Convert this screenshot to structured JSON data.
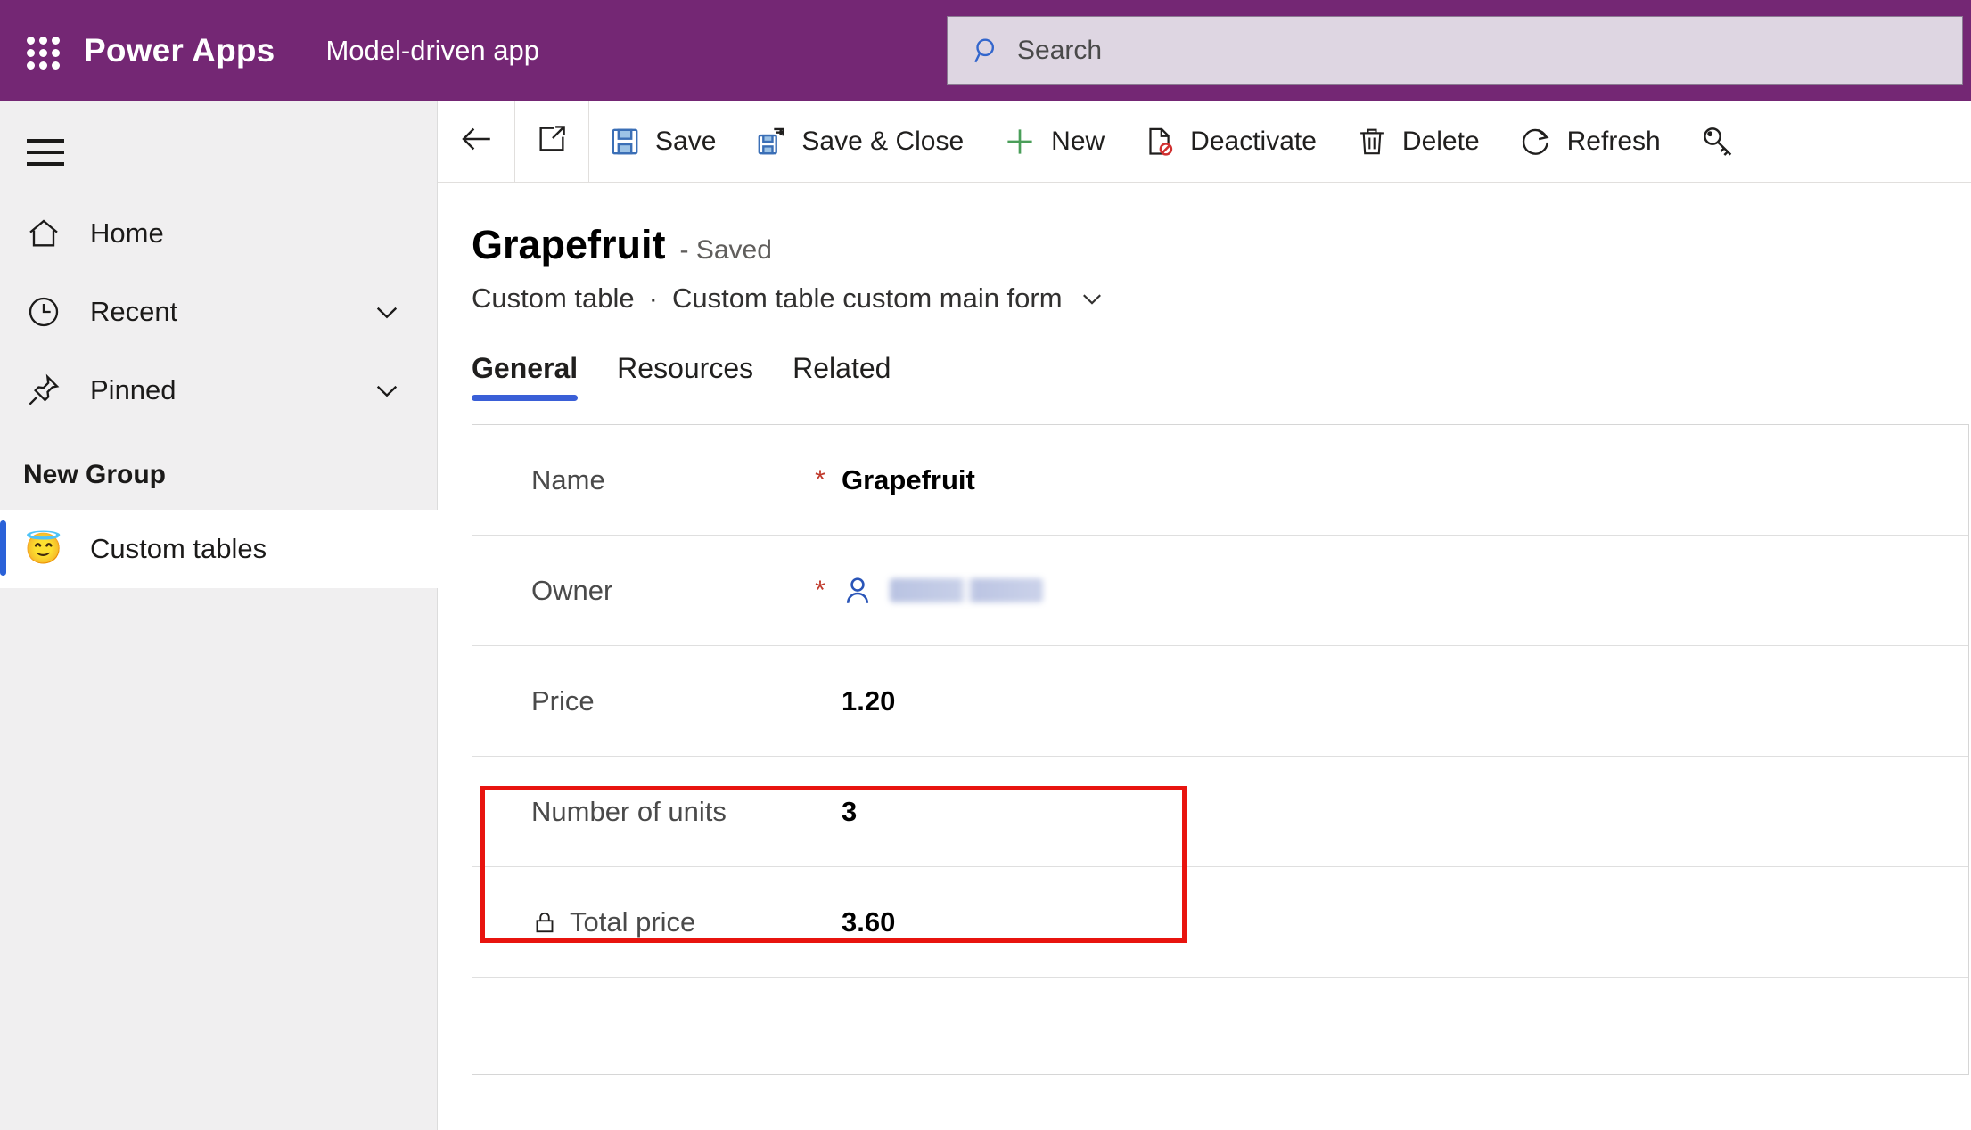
{
  "topbar": {
    "waffle_icon": "app-launcher-waffle-icon",
    "brand": "Power Apps",
    "app_name": "Model-driven app",
    "search": {
      "icon": "search-icon",
      "placeholder": "Search",
      "value": ""
    },
    "colors": {
      "background": "#742774",
      "search_background": "#ded6e2"
    }
  },
  "sidebar": {
    "hamburger_label": "Site map",
    "items": [
      {
        "label": "Home",
        "icon": "home-icon",
        "chevron": false,
        "selected": false
      },
      {
        "label": "Recent",
        "icon": "clock-icon",
        "chevron": true,
        "selected": false
      },
      {
        "label": "Pinned",
        "icon": "pin-icon",
        "chevron": true,
        "selected": false
      }
    ],
    "group_title": "New Group",
    "group_items": [
      {
        "label": "Custom tables",
        "icon": "angel-face-emoji-icon",
        "emoji": "😇",
        "selected": true
      }
    ],
    "colors": {
      "background": "#f0eff0",
      "selection_bar": "#2a61d8"
    }
  },
  "command_bar": {
    "back_icon": "back-arrow-icon",
    "popout_icon": "open-in-new-window-icon",
    "buttons": [
      {
        "label": "Save",
        "icon": "save-floppy-icon"
      },
      {
        "label": "Save & Close",
        "icon": "save-and-close-icon"
      },
      {
        "label": "New",
        "icon": "plus-icon"
      },
      {
        "label": "Deactivate",
        "icon": "deactivate-icon"
      },
      {
        "label": "Delete",
        "icon": "trash-icon"
      },
      {
        "label": "Refresh",
        "icon": "refresh-icon"
      }
    ],
    "trailing_icon": "key-check-access-icon"
  },
  "record": {
    "title": "Grapefruit",
    "state": "- Saved",
    "entity": "Custom table",
    "separator": "·",
    "form_name": "Custom table custom main form",
    "form_chevron_icon": "chevron-down-icon"
  },
  "tabs": [
    {
      "label": "General",
      "active": true
    },
    {
      "label": "Resources",
      "active": false
    },
    {
      "label": "Related",
      "active": false
    }
  ],
  "form": {
    "fields": [
      {
        "label": "Name",
        "required": true,
        "value": "Grapefruit",
        "locked": false,
        "kind": "text"
      },
      {
        "label": "Owner",
        "required": true,
        "value": "",
        "locked": false,
        "kind": "lookup",
        "icon": "person-icon",
        "redacted": true
      },
      {
        "label": "Price",
        "required": false,
        "value": "1.20",
        "locked": false,
        "kind": "number"
      },
      {
        "label": "Number of units",
        "required": false,
        "value": "3",
        "locked": false,
        "kind": "number"
      },
      {
        "label": "Total price",
        "required": false,
        "value": "3.60",
        "locked": true,
        "locked_icon": "lock-icon",
        "kind": "calculated"
      }
    ]
  },
  "annotation": {
    "type": "red-rectangle-highlight",
    "color": "#e8140f",
    "targets": "Total price"
  }
}
